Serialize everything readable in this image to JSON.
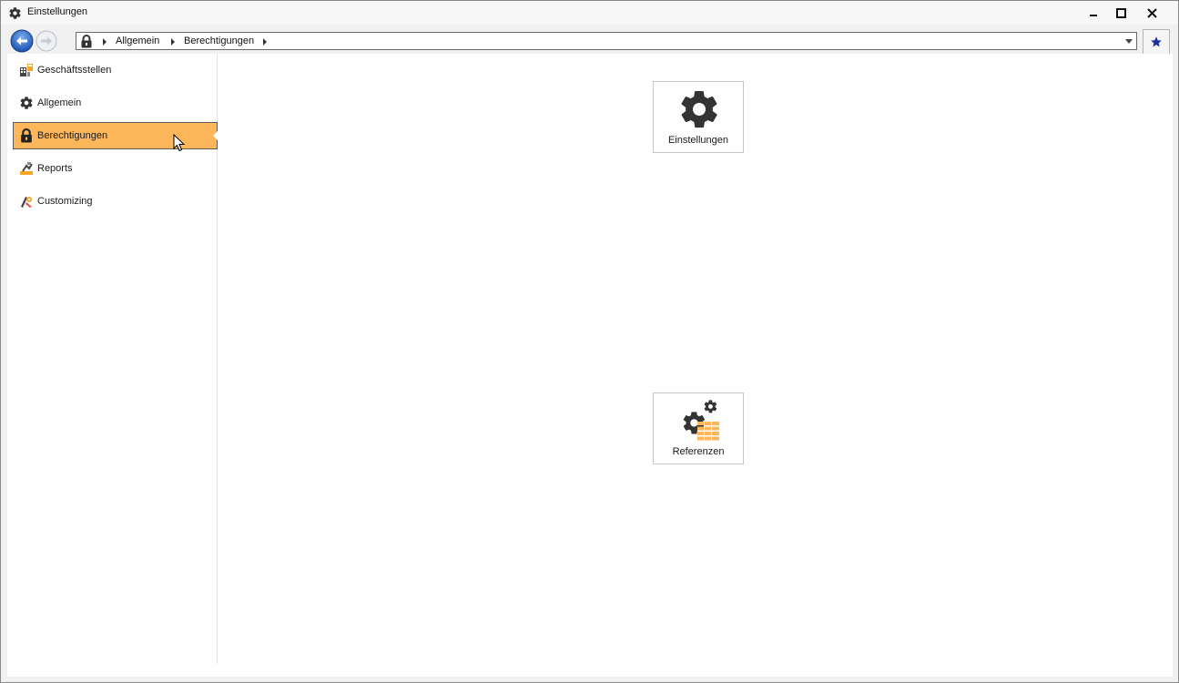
{
  "window": {
    "title": "Einstellungen",
    "icon": "gear-icon"
  },
  "navbar": {
    "breadcrumbs": [
      "Allgemein",
      "Berechtigungen"
    ],
    "lock_icon": "lock-icon"
  },
  "sidebar": {
    "items": [
      {
        "label": "Geschäftsstellen",
        "icon": "building-icon",
        "active": false
      },
      {
        "label": "Allgemein",
        "icon": "gear-icon",
        "active": false
      },
      {
        "label": "Berechtigungen",
        "icon": "lock-icon",
        "active": true
      },
      {
        "label": "Reports",
        "icon": "report-icon",
        "active": false
      },
      {
        "label": "Customizing",
        "icon": "customizing-icon",
        "active": false
      }
    ]
  },
  "tiles": [
    {
      "label": "Einstellungen",
      "icon": "gear-icon"
    },
    {
      "label": "Referenzen",
      "icon": "references-icon"
    }
  ],
  "colors": {
    "accent": "#fdb65a",
    "icon_dark": "#333333",
    "nav_blue": "#2a63b8",
    "star": "#1a2f9c"
  }
}
